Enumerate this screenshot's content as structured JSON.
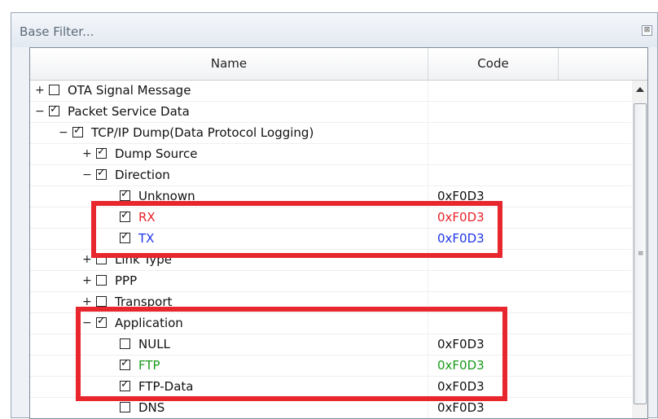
{
  "window": {
    "title": "Base Filter..."
  },
  "columns": {
    "name": "Name",
    "code": "Code"
  },
  "rows": [
    {
      "exp": "+",
      "checked": false,
      "label": "OTA Signal Message",
      "code": "",
      "level": 0
    },
    {
      "exp": "−",
      "checked": true,
      "label": "Packet Service Data",
      "code": "",
      "level": 0
    },
    {
      "exp": "−",
      "checked": true,
      "label": "TCP/IP Dump(Data Protocol Logging)",
      "code": "",
      "level": 1
    },
    {
      "exp": "+",
      "checked": true,
      "label": "Dump Source",
      "code": "",
      "level": 2
    },
    {
      "exp": "−",
      "checked": true,
      "label": "Direction",
      "code": "",
      "level": 2
    },
    {
      "exp": "",
      "checked": true,
      "label": "Unknown",
      "code": "0xF0D3",
      "level": 3
    },
    {
      "exp": "",
      "checked": true,
      "label": "RX",
      "code": "0xF0D3",
      "level": 3,
      "color": "#e8232b"
    },
    {
      "exp": "",
      "checked": true,
      "label": "TX",
      "code": "0xF0D3",
      "level": 3,
      "color": "#1f35e8"
    },
    {
      "exp": "+",
      "checked": false,
      "label": "Link Type",
      "code": "",
      "level": 2
    },
    {
      "exp": "+",
      "checked": false,
      "label": "PPP",
      "code": "",
      "level": 2
    },
    {
      "exp": "+",
      "checked": false,
      "label": "Transport",
      "code": "",
      "level": 2
    },
    {
      "exp": "−",
      "checked": true,
      "label": "Application",
      "code": "",
      "level": 2
    },
    {
      "exp": "",
      "checked": false,
      "label": "NULL",
      "code": "0xF0D3",
      "level": 3
    },
    {
      "exp": "",
      "checked": true,
      "label": "FTP",
      "code": "0xF0D3",
      "level": 3,
      "color": "#1a9a1a"
    },
    {
      "exp": "",
      "checked": true,
      "label": "FTP-Data",
      "code": "0xF0D3",
      "level": 3
    },
    {
      "exp": "",
      "checked": false,
      "label": "DNS",
      "code": "0xF0D3",
      "level": 3
    }
  ],
  "icons": {
    "close": "close-icon",
    "scroll_up": "arrow-up-icon"
  }
}
